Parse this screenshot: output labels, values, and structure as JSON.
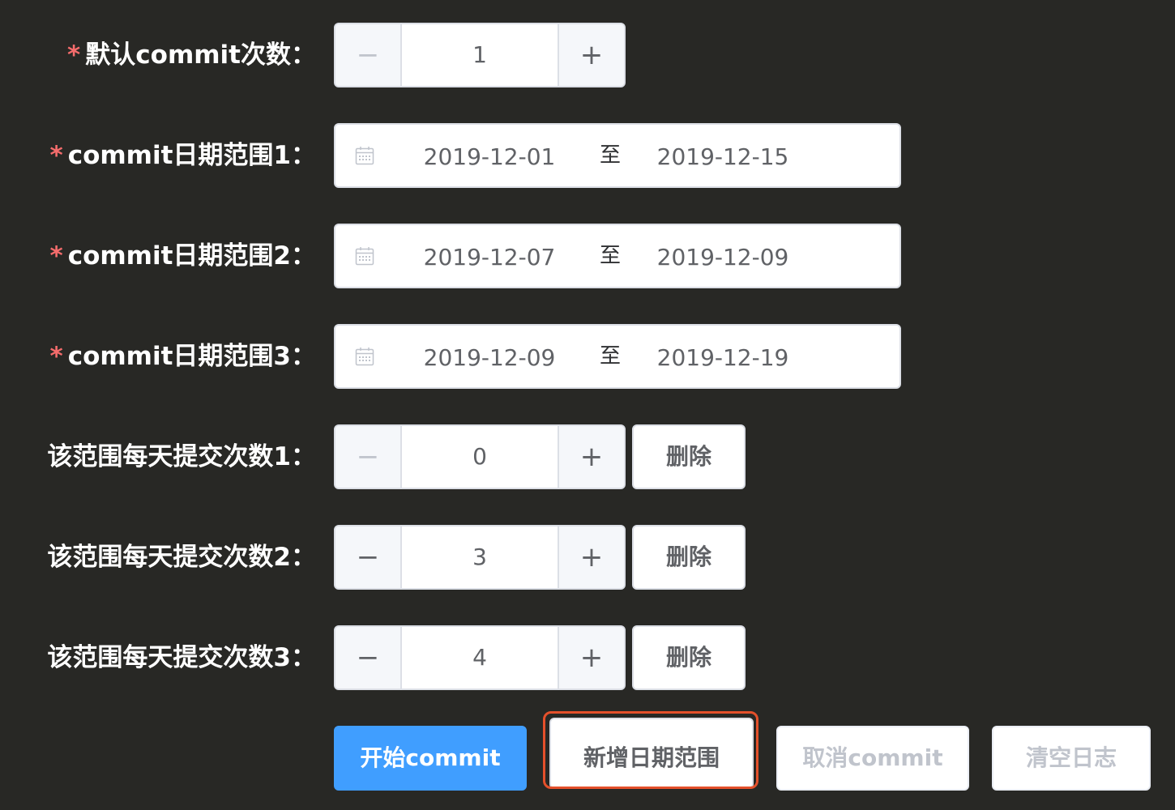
{
  "form": {
    "default_commits": {
      "required_mark": "*",
      "label": "默认commit次数：",
      "value": "1",
      "minus_icon": "−",
      "plus_icon": "+",
      "minus_disabled": true
    },
    "date_ranges": [
      {
        "required_mark": "*",
        "label": "commit日期范围1：",
        "start": "2019-12-01",
        "separator": "至",
        "end": "2019-12-15"
      },
      {
        "required_mark": "*",
        "label": "commit日期范围2：",
        "start": "2019-12-07",
        "separator": "至",
        "end": "2019-12-09"
      },
      {
        "required_mark": "*",
        "label": "commit日期范围3：",
        "start": "2019-12-09",
        "separator": "至",
        "end": "2019-12-19"
      }
    ],
    "daily_counts": [
      {
        "label": "该范围每天提交次数1：",
        "value": "0",
        "minus_disabled": true,
        "delete_label": "删除"
      },
      {
        "label": "该范围每天提交次数2：",
        "value": "3",
        "minus_disabled": false,
        "delete_label": "删除"
      },
      {
        "label": "该范围每天提交次数3：",
        "value": "4",
        "minus_disabled": false,
        "delete_label": "删除"
      }
    ],
    "stepper_icons": {
      "minus": "−",
      "plus": "+"
    }
  },
  "actions": {
    "start_label": "开始commit",
    "add_range_label": "新增日期范围",
    "cancel_label": "取消commit",
    "clear_log_label": "清空日志"
  },
  "colors": {
    "background": "#282825",
    "primary": "#409eff",
    "required": "#f56c6c",
    "highlight": "#e4502b"
  },
  "icons": {
    "calendar": "calendar-icon",
    "minus": "minus-icon",
    "plus": "plus-icon"
  }
}
